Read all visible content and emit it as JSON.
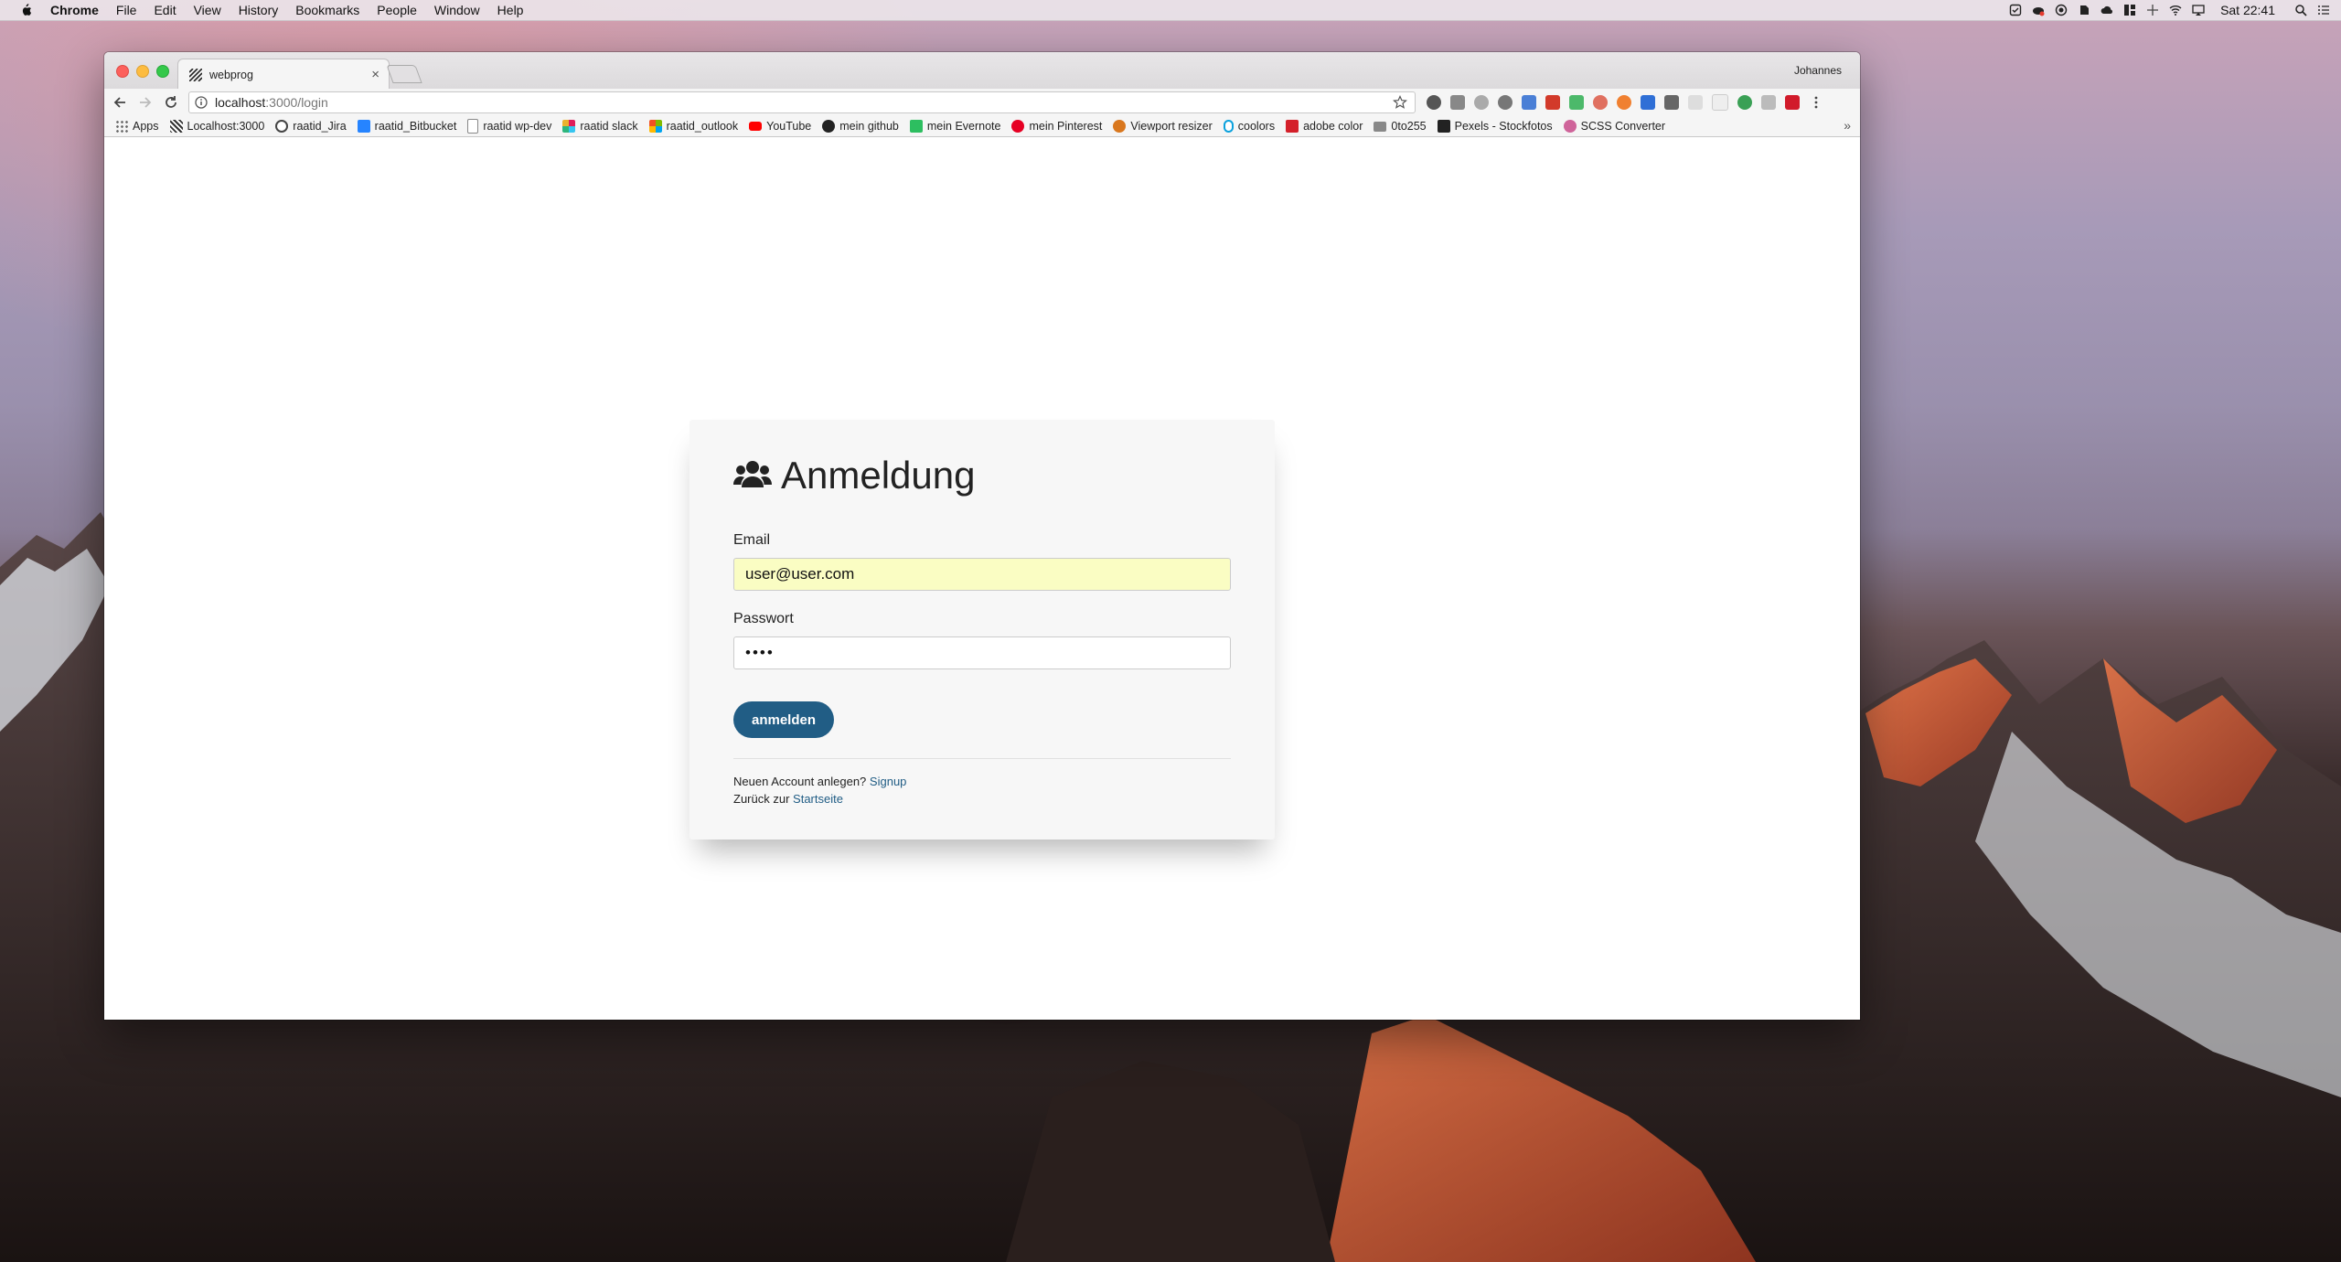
{
  "menubar": {
    "app": "Chrome",
    "items": [
      "File",
      "Edit",
      "View",
      "History",
      "Bookmarks",
      "People",
      "Window",
      "Help"
    ],
    "clock": "Sat 22:41"
  },
  "browser": {
    "tab_title": "webprog",
    "tab_close": "×",
    "profile": "Johannes",
    "url_host": "localhost",
    "url_path": ":3000/login",
    "bookmarks": [
      {
        "label": "Apps",
        "icon": "apps-grid-icon",
        "color": "#777777"
      },
      {
        "label": "Localhost:3000",
        "icon": "stripes-icon",
        "color": "#333333"
      },
      {
        "label": "raatid_Jira",
        "icon": "jira-icon",
        "color": "#444444"
      },
      {
        "label": "raatid_Bitbucket",
        "icon": "bitbucket-icon",
        "color": "#2684ff"
      },
      {
        "label": "raatid wp-dev",
        "icon": "page-icon",
        "color": "#dddddd"
      },
      {
        "label": "raatid slack",
        "icon": "slack-icon",
        "color": "#e01e5a"
      },
      {
        "label": "raatid_outlook",
        "icon": "microsoft-icon",
        "color": "#f25022"
      },
      {
        "label": "YouTube",
        "icon": "youtube-icon",
        "color": "#ff0000"
      },
      {
        "label": "mein github",
        "icon": "github-icon",
        "color": "#222222"
      },
      {
        "label": "mein Evernote",
        "icon": "evernote-icon",
        "color": "#2dbe60"
      },
      {
        "label": "mein Pinterest",
        "icon": "pinterest-icon",
        "color": "#e60023"
      },
      {
        "label": "Viewport resizer",
        "icon": "viewport-icon",
        "color": "#d9771e"
      },
      {
        "label": "coolors",
        "icon": "coolors-icon",
        "color": "#0aa1dd"
      },
      {
        "label": "adobe color",
        "icon": "adobe-icon",
        "color": "#d4202a"
      },
      {
        "label": "0to255",
        "icon": "folder-icon",
        "color": "#888888"
      },
      {
        "label": "Pexels - Stockfotos",
        "icon": "pexels-icon",
        "color": "#222222"
      },
      {
        "label": "SCSS Converter",
        "icon": "sass-icon",
        "color": "#cf649a"
      }
    ],
    "bookmarks_more": "»"
  },
  "login": {
    "title": "Anmeldung",
    "email_label": "Email",
    "email_value": "user@user.com",
    "password_label": "Passwort",
    "password_value": "••••",
    "submit_label": "anmelden",
    "signup_prefix": "Neuen Account anlegen?",
    "signup_link": "Signup",
    "home_prefix": "Zurück zur",
    "home_link": "Startseite"
  },
  "colors": {
    "primary_button": "#215d85",
    "autofill": "#fafdc3"
  }
}
